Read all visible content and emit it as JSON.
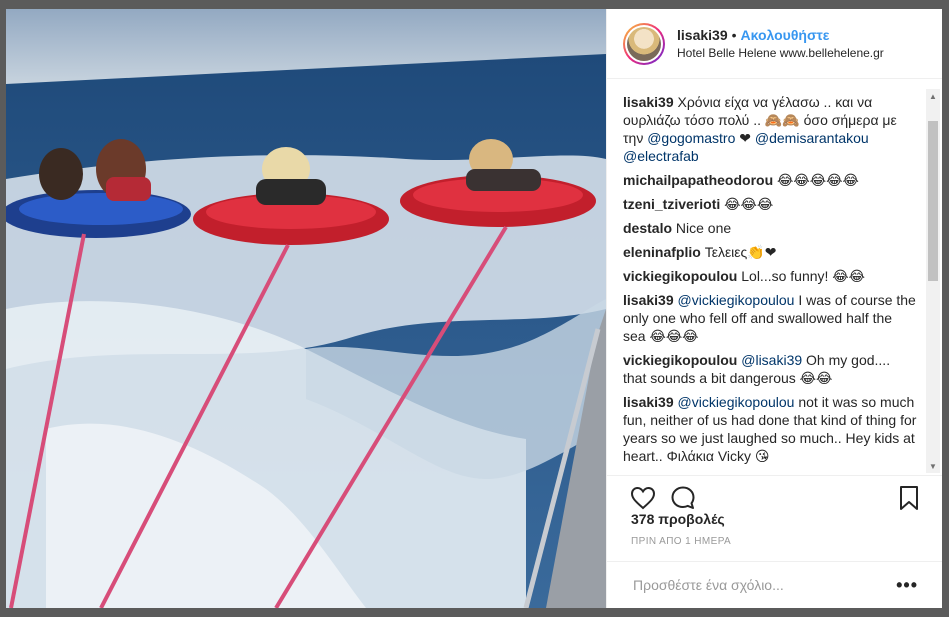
{
  "post": {
    "username": "lisaki39",
    "separator": "•",
    "follow_label": "Ακολουθήστε",
    "location": "Hotel Belle Helene www.bellehelene.gr"
  },
  "comments": [
    {
      "user": "lisaki39",
      "parts": [
        {
          "t": "Χρόνια είχα να γέλασω .. και να ουρλιάζω τόσο πολύ .. 🙈🙈 όσο σήμερα με την "
        },
        {
          "t": "@gogomastro",
          "link": true
        },
        {
          "t": " ❤ "
        },
        {
          "t": "@demisarantakou",
          "link": true
        },
        {
          "t": " "
        },
        {
          "t": "@electrafab",
          "link": true
        }
      ]
    },
    {
      "user": "michailpapatheodorou",
      "parts": [
        {
          "t": "😂😂😂😂😂"
        }
      ]
    },
    {
      "user": "tzeni_tziverioti",
      "parts": [
        {
          "t": "😂😂😂"
        }
      ]
    },
    {
      "user": "destalo",
      "parts": [
        {
          "t": "Nice one"
        }
      ]
    },
    {
      "user": "eleninafplio",
      "parts": [
        {
          "t": "Τελειες👏❤"
        }
      ]
    },
    {
      "user": "vickiegikopoulou",
      "parts": [
        {
          "t": "Lol...so funny! 😂😂"
        }
      ]
    },
    {
      "user": "lisaki39",
      "parts": [
        {
          "t": "@vickiegikopoulou",
          "link": true
        },
        {
          "t": " I was of course the only one who fell off and swallowed half the sea 😂😂😂"
        }
      ]
    },
    {
      "user": "vickiegikopoulou",
      "parts": [
        {
          "t": "@lisaki39",
          "link": true
        },
        {
          "t": " Oh my god.... that sounds a bit dangerous 😂😂"
        }
      ]
    },
    {
      "user": "lisaki39",
      "parts": [
        {
          "t": "@vickiegikopoulou",
          "link": true
        },
        {
          "t": " not it was so much fun, neither of us had done that kind of thing for years so we just laughed so much.. Hey kids at heart.. Φιλάκια Vicky 😘"
        }
      ]
    }
  ],
  "stats": {
    "views": "378 προβολές",
    "time": "ΠΡΙΝ ΑΠΟ 1 ΗΜΕΡΑ"
  },
  "add_comment": {
    "placeholder": "Προσθέστε ένα σχόλιο...",
    "more_label": "•••"
  },
  "icons": {
    "like": "heart-outline-icon",
    "comment": "speech-bubble-icon",
    "save": "bookmark-icon"
  },
  "colors": {
    "link": "#003569",
    "follow": "#3897f0"
  }
}
